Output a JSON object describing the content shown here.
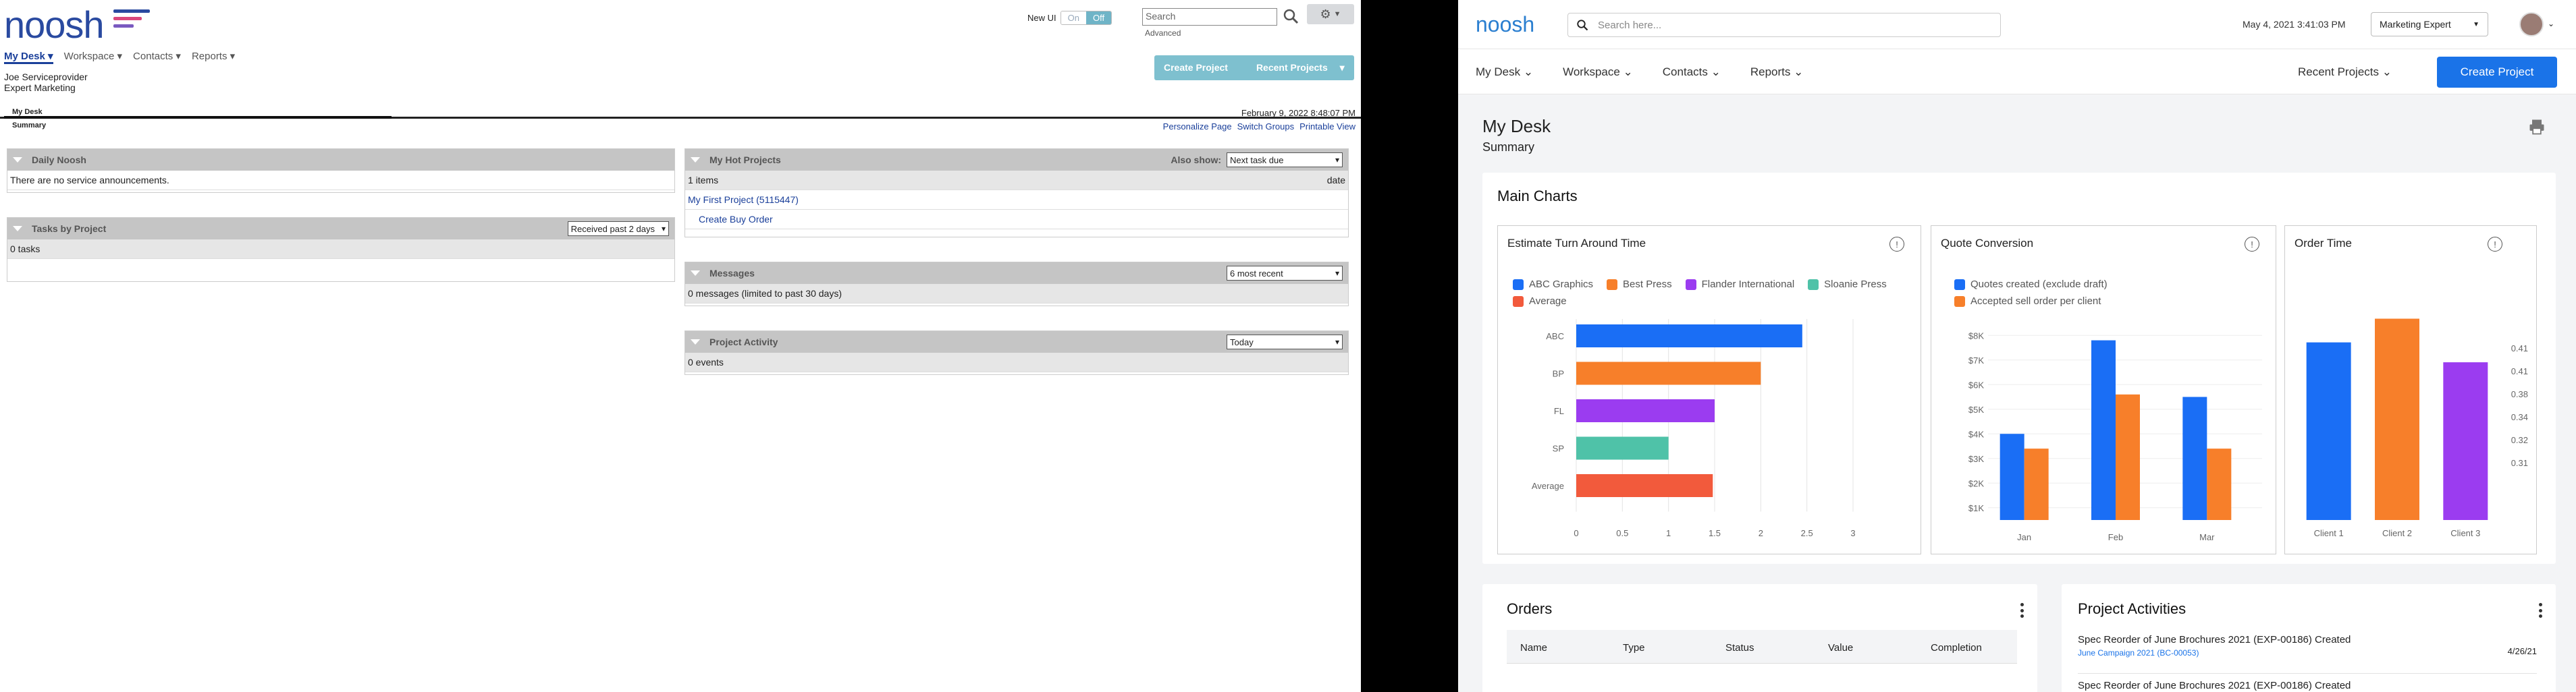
{
  "legacy": {
    "logo": "noosh",
    "nav": [
      "My Desk",
      "Workspace",
      "Contacts",
      "Reports"
    ],
    "new_ui_label": "New UI",
    "toggle_on": "On",
    "toggle_off": "Off",
    "search_placeholder": "Search",
    "advanced": "Advanced",
    "user_name": "Joe Serviceprovider",
    "user_org": "Expert Marketing",
    "create_project": "Create Project",
    "recent_projects": "Recent Projects",
    "tab": "My Desk",
    "subtab": "Summary",
    "datetime": "February 9, 2022 8:48:07 PM",
    "links": [
      "Personalize Page",
      "Switch Groups",
      "Printable View"
    ],
    "daily_noosh": {
      "title": "Daily Noosh",
      "text": "There are no service announcements."
    },
    "tasks": {
      "title": "Tasks by Project",
      "filter": "Received past 2 days",
      "count": "0 tasks"
    },
    "hot_projects": {
      "title": "My Hot Projects",
      "also_show": "Also show:",
      "filter": "Next task due",
      "items": "1 items",
      "date_col": "date",
      "project": "My First Project (5115447)",
      "action": "Create Buy Order"
    },
    "messages": {
      "title": "Messages",
      "filter": "6 most recent",
      "text": "0 messages (limited to past 30 days)"
    },
    "activity": {
      "title": "Project Activity",
      "filter": "Today",
      "text": "0 events"
    }
  },
  "newui": {
    "logo": "noosh",
    "search_placeholder": "Search here...",
    "datetime": "May 4, 2021 3:41:03 PM",
    "role": "Marketing Expert",
    "nav": [
      "My Desk",
      "Workspace",
      "Contacts",
      "Reports"
    ],
    "recent_projects": "Recent Projects",
    "create_project": "Create Project",
    "title": "My Desk",
    "subtitle": "Summary",
    "main_charts": "Main Charts",
    "orders": {
      "title": "Orders",
      "columns": [
        "Name",
        "Type",
        "Status",
        "Value",
        "Completion"
      ]
    },
    "activities": {
      "title": "Project Activities",
      "items": [
        {
          "title": "Spec Reorder of June Brochures 2021 (EXP-00186) Created",
          "link": "June Campaign 2021 (BC-00053)",
          "date": "4/26/21"
        },
        {
          "title": "Spec Reorder of June Brochures 2021 (EXP-00186) Created",
          "link": "",
          "date": ""
        }
      ]
    }
  },
  "chart_data": [
    {
      "type": "bar",
      "orientation": "horizontal",
      "title": "Estimate Turn Around Time",
      "categories": [
        "ABC",
        "BP",
        "FL",
        "SP",
        "Average"
      ],
      "legend": [
        "ABC Graphics",
        "Best Press",
        "Flander International",
        "Sloanie Press",
        "Average"
      ],
      "colors": [
        "#1a6ef5",
        "#f77f2a",
        "#9b3cf0",
        "#4fc2a8",
        "#f25a3c"
      ],
      "values": [
        2.45,
        2.0,
        1.5,
        1.0,
        1.48
      ],
      "xlim": [
        0,
        3
      ],
      "xticks": [
        "0",
        "0.5",
        "1",
        "1.5",
        "2",
        "2.5",
        "3"
      ]
    },
    {
      "type": "bar",
      "title": "Quote Conversion",
      "categories": [
        "Jan",
        "Feb",
        "Mar"
      ],
      "series": [
        {
          "name": "Quotes created (exclude draft)",
          "color": "#1a6ef5",
          "values": [
            4.0,
            7.8,
            5.5
          ]
        },
        {
          "name": "Accepted sell order per client",
          "color": "#f77f2a",
          "values": [
            3.4,
            5.6,
            3.4
          ]
        }
      ],
      "ylim": [
        0.5,
        8.5
      ],
      "yticks": [
        "$8K",
        "$7K",
        "$6K",
        "$5K",
        "$4K",
        "$3K",
        "$2K",
        "$1K"
      ]
    },
    {
      "type": "bar",
      "title": "Order Time",
      "categories": [
        "Client 1",
        "Client 2",
        "Client 3"
      ],
      "colors": [
        "#1a6ef5",
        "#f77f2a",
        "#9b3cf0"
      ],
      "values": [
        0.375,
        0.425,
        0.333
      ],
      "yticks": [
        "0.41",
        "0.41",
        "0.38",
        "0.34",
        "0.32",
        "0.31"
      ]
    }
  ]
}
